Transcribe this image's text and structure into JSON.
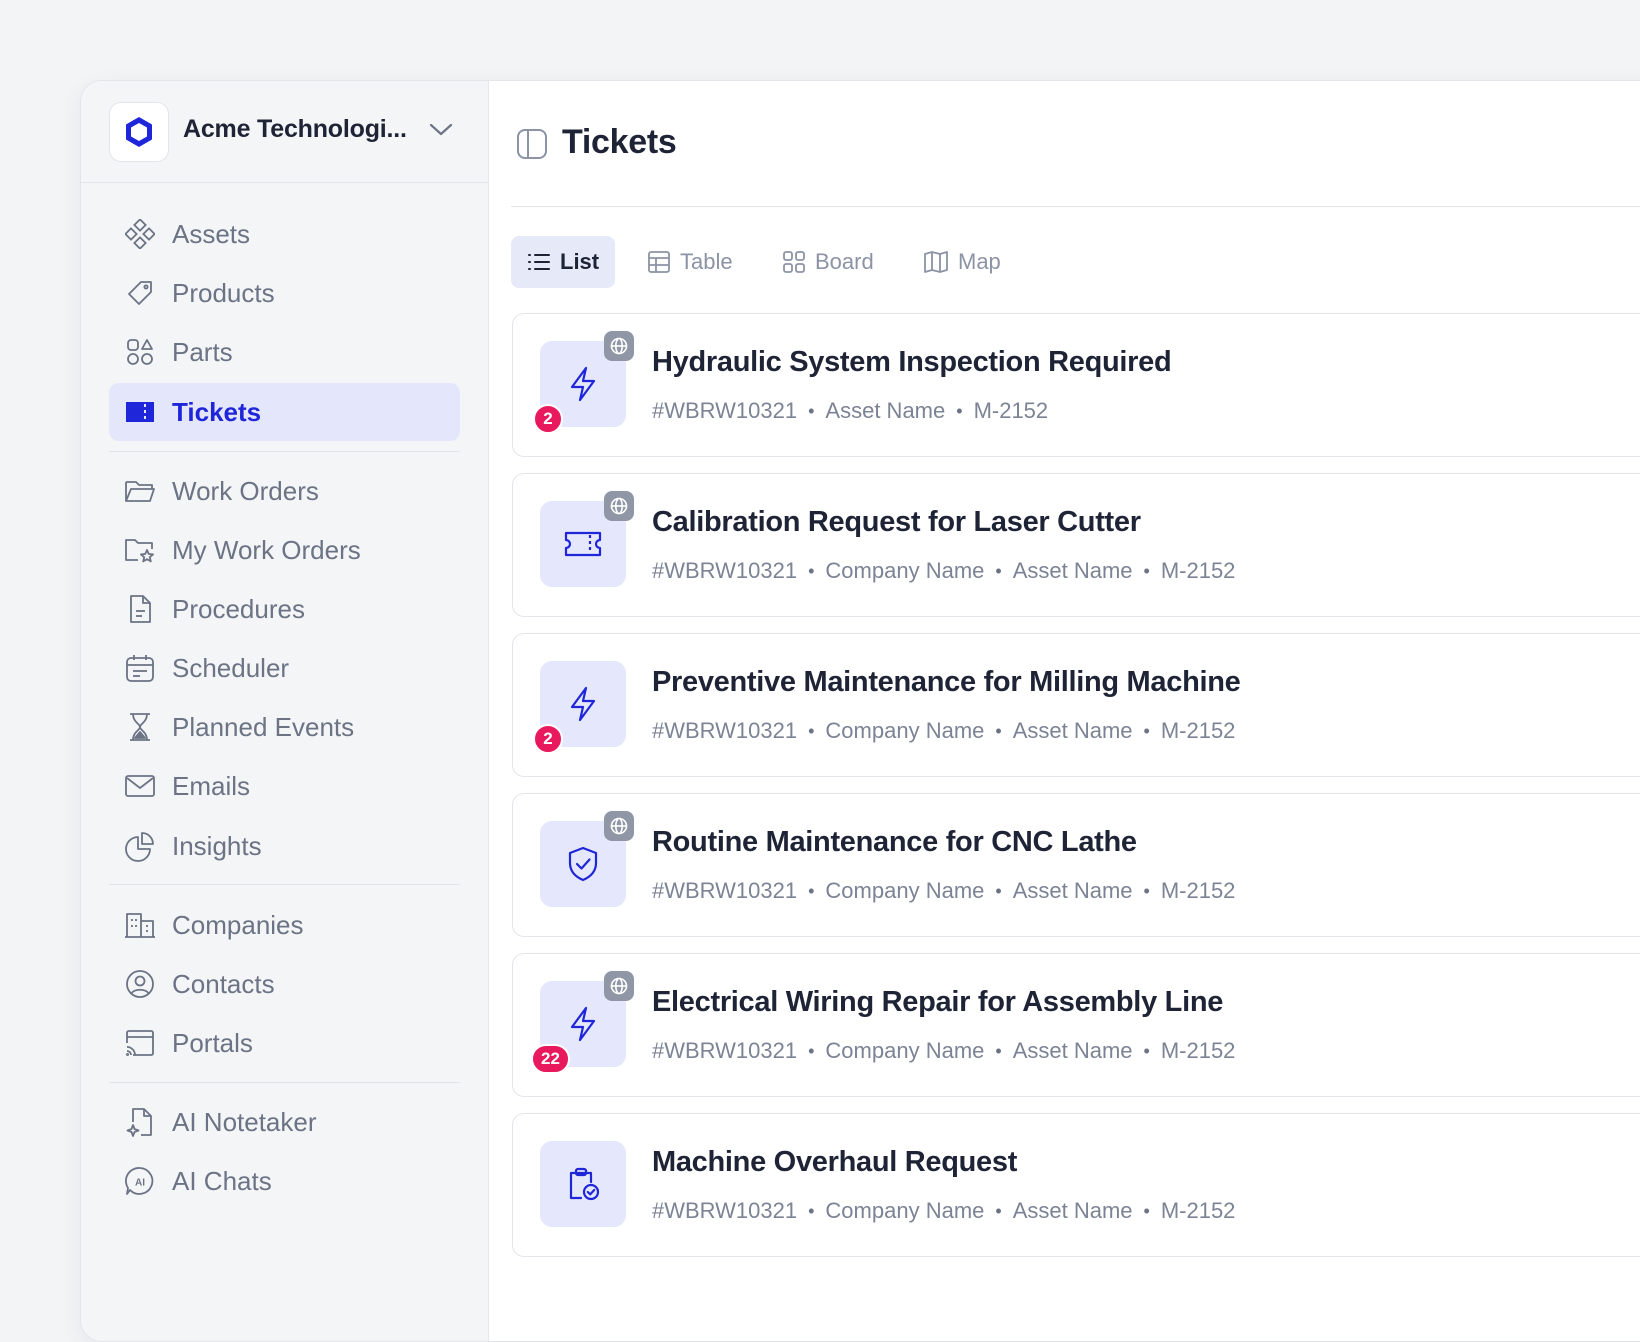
{
  "org": {
    "name": "Acme Technologi..."
  },
  "nav": {
    "assets": "Assets",
    "products": "Products",
    "parts": "Parts",
    "tickets": "Tickets",
    "work_orders": "Work Orders",
    "my_work_orders": "My Work Orders",
    "procedures": "Procedures",
    "scheduler": "Scheduler",
    "planned_events": "Planned Events",
    "emails": "Emails",
    "insights": "Insights",
    "companies": "Companies",
    "contacts": "Contacts",
    "portals": "Portals",
    "ai_notetaker": "AI Notetaker",
    "ai_chats": "AI Chats"
  },
  "page": {
    "title": "Tickets"
  },
  "views": {
    "list": "List",
    "table": "Table",
    "board": "Board",
    "map": "Map"
  },
  "tickets": [
    {
      "title": "Hydraulic System Inspection Required",
      "id": "#WBRW10321",
      "company": "",
      "asset": "Asset Name",
      "code": "M-2152",
      "icon": "bolt-icon",
      "count": "2",
      "globe": true
    },
    {
      "title": "Calibration Request for Laser Cutter",
      "id": "#WBRW10321",
      "company": "Company Name",
      "asset": "Asset Name",
      "code": "M-2152",
      "icon": "ticket-icon",
      "count": "",
      "globe": true
    },
    {
      "title": "Preventive Maintenance for Milling Machine",
      "id": "#WBRW10321",
      "company": "Company Name",
      "asset": "Asset Name",
      "code": "M-2152",
      "icon": "bolt-icon",
      "count": "2",
      "globe": false
    },
    {
      "title": "Routine Maintenance for CNC Lathe",
      "id": "#WBRW10321",
      "company": "Company Name",
      "asset": "Asset Name",
      "code": "M-2152",
      "icon": "shield-check-icon",
      "count": "",
      "globe": true
    },
    {
      "title": "Electrical Wiring Repair for Assembly Line",
      "id": "#WBRW10321",
      "company": "Company Name",
      "asset": "Asset Name",
      "code": "M-2152",
      "icon": "bolt-icon",
      "count": "22",
      "globe": true
    },
    {
      "title": "Machine Overhaul Request",
      "id": "#WBRW10321",
      "company": "Company Name",
      "asset": "Asset Name",
      "code": "M-2152",
      "icon": "clipboard-check-icon",
      "count": "",
      "globe": false
    }
  ],
  "colors": {
    "accent": "#1f26d9",
    "badge": "#e8195d",
    "active_bg": "#e4e7fb"
  }
}
